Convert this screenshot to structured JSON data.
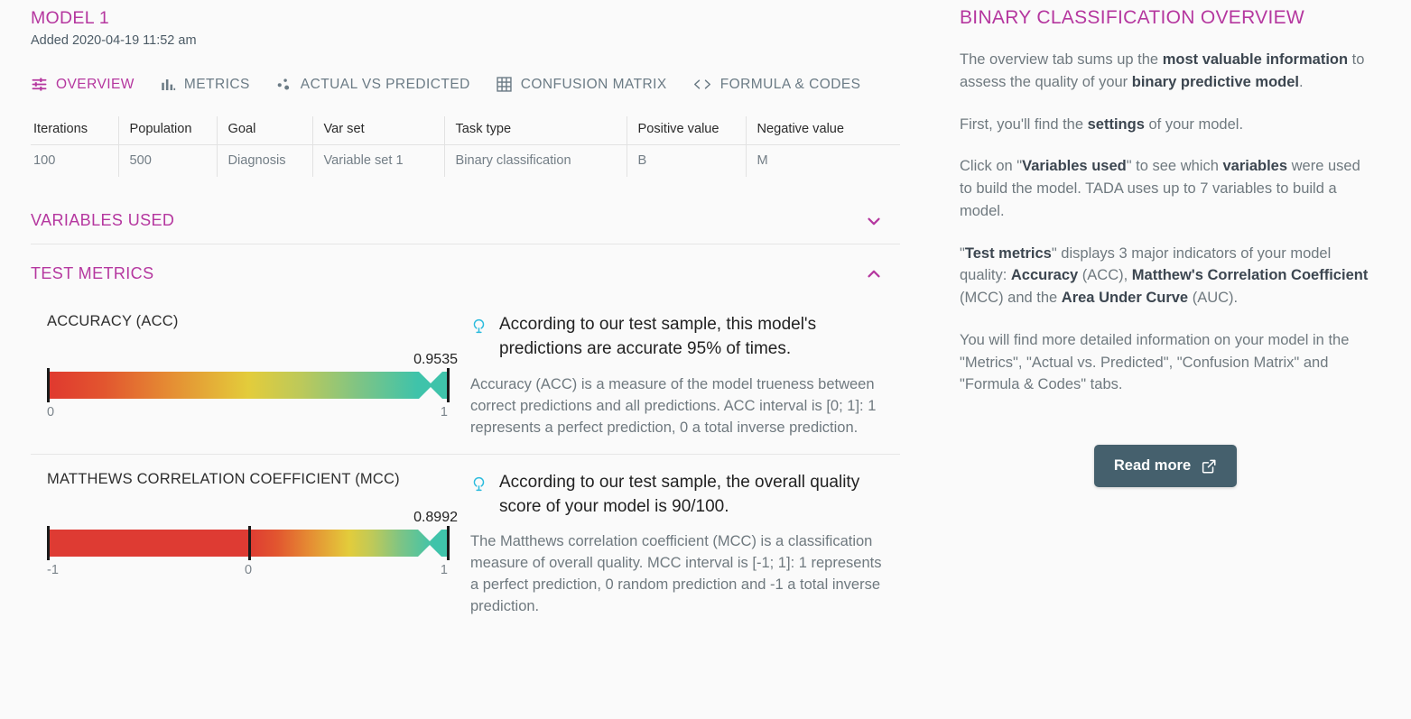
{
  "model": {
    "title": "MODEL 1",
    "added": "Added 2020-04-19 11:52 am"
  },
  "tabs": [
    {
      "label": "OVERVIEW",
      "icon": "tune-icon",
      "active": true
    },
    {
      "label": "METRICS",
      "icon": "bar-chart-icon",
      "active": false
    },
    {
      "label": "ACTUAL VS PREDICTED",
      "icon": "scatter-plot-icon",
      "active": false
    },
    {
      "label": "CONFUSION MATRIX",
      "icon": "grid-icon",
      "active": false
    },
    {
      "label": "FORMULA & CODES",
      "icon": "code-brackets-icon",
      "active": false
    }
  ],
  "settings_table": {
    "headers": [
      "Iterations",
      "Population",
      "Goal",
      "Var set",
      "Task type",
      "Positive value",
      "Negative value"
    ],
    "row": [
      "100",
      "500",
      "Diagnosis",
      "Variable set 1",
      "Binary classification",
      "B",
      "M"
    ]
  },
  "sections": {
    "variables_used": {
      "title": "VARIABLES USED",
      "expanded": false,
      "chevron": "chevron-down-icon"
    },
    "test_metrics": {
      "title": "TEST METRICS",
      "expanded": true,
      "chevron": "chevron-up-icon"
    }
  },
  "metrics": [
    {
      "name": "ACCURACY (ACC)",
      "value": "0.9535",
      "axis_min_label": "0",
      "axis_mid_label": "",
      "axis_max_label": "1",
      "headline": "According to our test sample, this model's predictions are accurate 95% of times.",
      "body": "Accuracy (ACC) is a measure of the model trueness between correct predictions and all predictions. ACC interval is [0; 1]: 1 represents a perfect prediction, 0 a total inverse prediction.",
      "icon": "lightbulb-icon"
    },
    {
      "name": "MATTHEWS CORRELATION COEFFICIENT (MCC)",
      "value": "0.8992",
      "axis_min_label": "-1",
      "axis_mid_label": "0",
      "axis_max_label": "1",
      "headline": "According to our test sample, the overall quality score of your model is 90/100.",
      "body": "The Matthews correlation coefficient (MCC) is a classification measure of overall quality. MCC interval is [-1; 1]: 1 represents a perfect prediction, 0 random prediction and -1 a total inverse prediction.",
      "icon": "lightbulb-icon"
    }
  ],
  "sidebar": {
    "title": "BINARY CLASSIFICATION OVERVIEW",
    "paragraphs": [
      "The overview tab sums up the <b>most valuable information</b> to assess the quality of your <b>binary predictive model</b>.",
      "First, you'll find the <b>settings</b> of your model.",
      "Click on \"<b>Variables used</b>\" to see which <b>variables</b> were used to build the model. TADA uses up to 7 variables to build a model.",
      "\"<b>Test metrics</b>\" displays 3 major indicators of your model quality: <b>Accuracy</b> (ACC), <b>Matthew's Correlation Coefficient</b> (MCC) and the <b>Area Under Curve</b> (AUC).",
      "You will find more detailed information on your model in the \"Metrics\", \"Actual vs. Predicted\", \"Confusion Matrix\" and \"Formula &amp; Codes\" tabs."
    ],
    "read_more_label": "Read more",
    "read_more_icon": "external-link-icon"
  },
  "chart_data": [
    {
      "type": "bar",
      "title": "ACCURACY (ACC)",
      "categories": [
        "ACC"
      ],
      "values": [
        0.9535
      ],
      "xlabel": "",
      "ylabel": "",
      "ylim": [
        0,
        1
      ],
      "tick_labels": [
        "0",
        "1"
      ],
      "marker_value": 0.9535,
      "gradient_stops": [
        "#e0382f",
        "#e58b33",
        "#e3cc3b",
        "#9ac66f",
        "#3fc3aa"
      ],
      "grid": false,
      "legend": "none"
    },
    {
      "type": "bar",
      "title": "MATTHEWS CORRELATION COEFFICIENT (MCC)",
      "categories": [
        "MCC"
      ],
      "values": [
        0.8992
      ],
      "xlabel": "",
      "ylabel": "",
      "ylim": [
        -1,
        1
      ],
      "tick_labels": [
        "-1",
        "0",
        "1"
      ],
      "marker_value": 0.8992,
      "gradient_stops": [
        "#e0382f",
        "#e0382f",
        "#e58b33",
        "#e3cc3b",
        "#9ac66f",
        "#3fc3aa"
      ],
      "grid": false,
      "legend": "none"
    }
  ],
  "colors": {
    "accent_purple": "#b5379f",
    "bulb_cyan": "#2bbbdd",
    "button_bg": "#45606d",
    "muted_text": "#6f797f",
    "page_bg": "#fafafa"
  }
}
